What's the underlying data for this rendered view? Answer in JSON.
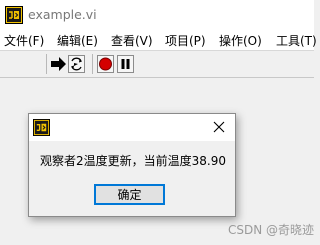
{
  "window": {
    "title": "example.vi",
    "icon": "labview-vi-icon"
  },
  "menu": {
    "items": [
      {
        "label": "文件(F)"
      },
      {
        "label": "编辑(E)"
      },
      {
        "label": "查看(V)"
      },
      {
        "label": "项目(P)"
      },
      {
        "label": "操作(O)"
      },
      {
        "label": "工具(T)"
      }
    ]
  },
  "toolbar": {
    "buttons": [
      {
        "icon": "run-arrow-icon"
      },
      {
        "icon": "run-continuously-icon"
      },
      {
        "icon": "abort-stop-icon"
      },
      {
        "icon": "pause-icon"
      }
    ]
  },
  "dialog": {
    "icon": "labview-vi-icon",
    "close_icon": "close-icon",
    "message": "观察者2温度更新，当前温度38.90",
    "ok_label": "确定"
  },
  "watermark": "CSDN @奇晓迹",
  "colors": {
    "accent": "#0078d7",
    "stop_red": "#d40000",
    "icon_yellow": "#f2c200"
  }
}
